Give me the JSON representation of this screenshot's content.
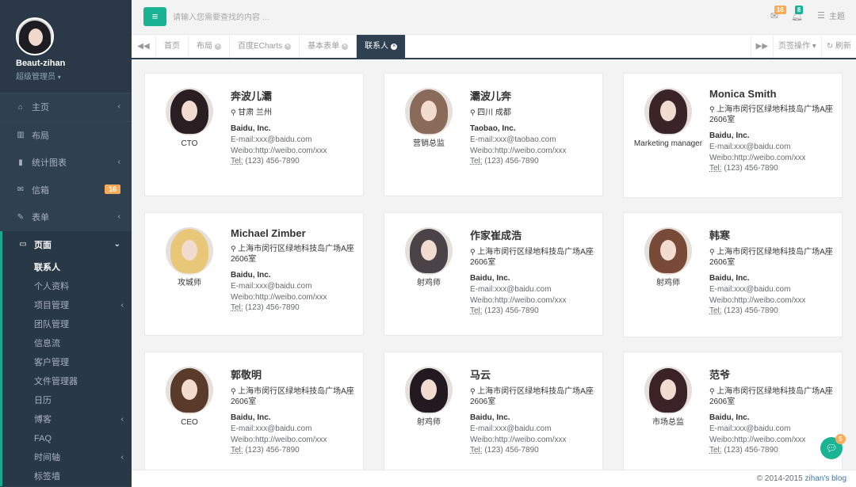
{
  "profile": {
    "name": "Beaut-zihan",
    "role": "超级管理员"
  },
  "sidebar": {
    "items": [
      {
        "label": "主页",
        "icon": "home-icon",
        "glyph": "⌂",
        "arrow": true
      },
      {
        "label": "布局",
        "icon": "columns-icon",
        "glyph": "▥",
        "arrow": false
      },
      {
        "label": "统计图表",
        "icon": "bar-chart-icon",
        "glyph": "▮",
        "arrow": true
      },
      {
        "label": "信箱",
        "icon": "envelope-icon",
        "glyph": "✉",
        "badge": "16"
      },
      {
        "label": "表单",
        "icon": "edit-icon",
        "glyph": "✎",
        "arrow": true
      },
      {
        "label": "页面",
        "icon": "desktop-icon",
        "glyph": "▭",
        "arrow": true
      }
    ],
    "sub_items": [
      {
        "label": "联系人",
        "current": true
      },
      {
        "label": "个人资料"
      },
      {
        "label": "项目管理",
        "arrow": true
      },
      {
        "label": "团队管理"
      },
      {
        "label": "信息流"
      },
      {
        "label": "客户管理"
      },
      {
        "label": "文件管理器"
      },
      {
        "label": "日历"
      },
      {
        "label": "博客",
        "arrow": true
      },
      {
        "label": "FAQ"
      },
      {
        "label": "时间轴",
        "arrow": true
      },
      {
        "label": "标签墙"
      }
    ]
  },
  "topbar": {
    "search_placeholder": "请输入您需要查找的内容 …",
    "messages_badge": "16",
    "alerts_badge": "8",
    "theme_label": "主题"
  },
  "tabs": {
    "items": [
      {
        "label": "首页",
        "closable": false
      },
      {
        "label": "布局",
        "closable": true
      },
      {
        "label": "百度ECharts",
        "closable": true
      },
      {
        "label": "基本表单",
        "closable": true
      },
      {
        "label": "联系人",
        "closable": true,
        "active": true
      }
    ],
    "tab_actions_label": "页签操作",
    "refresh_label": "刷新"
  },
  "contacts": [
    {
      "name": "奔波儿灞",
      "address": "甘肃 兰州",
      "role": "CTO",
      "company": "Baidu, Inc.",
      "email": "E-mail:xxx@baidu.com",
      "weibo": "Weibo:http://weibo.com/xxx",
      "tel_label": "Tel:",
      "tel": " (123) 456-7890",
      "hair": "#2a1e22"
    },
    {
      "name": "灞波儿奔",
      "address": "四川 成都",
      "role": "营销总监",
      "company": "Taobao, Inc.",
      "email": "E-mail:xxx@taobao.com",
      "weibo": "Weibo:http://weibo.com/xxx",
      "tel_label": "Tel:",
      "tel": " (123) 456-7890",
      "hair": "#8a6a58"
    },
    {
      "name": "Monica Smith",
      "address": "上海市闵行区绿地科技岛广场A座2606室",
      "role": "Marketing manager",
      "company": "Baidu, Inc.",
      "email": "E-mail:xxx@baidu.com",
      "weibo": "Weibo:http://weibo.com/xxx",
      "tel_label": "Tel:",
      "tel": " (123) 456-7890",
      "hair": "#3a2428"
    },
    {
      "name": "Michael Zimber",
      "address": "上海市闵行区绿地科技岛广场A座2606室",
      "role": "攻城师",
      "company": "Baidu, Inc.",
      "email": "E-mail:xxx@baidu.com",
      "weibo": "Weibo:http://weibo.com/xxx",
      "tel_label": "Tel:",
      "tel": " (123) 456-7890",
      "hair": "#e8c878"
    },
    {
      "name": "作家崔成浩",
      "address": "上海市闵行区绿地科技岛广场A座2606室",
      "role": "射鸡师",
      "company": "Baidu, Inc.",
      "email": "E-mail:xxx@baidu.com",
      "weibo": "Weibo:http://weibo.com/xxx",
      "tel_label": "Tel:",
      "tel": " (123) 456-7890",
      "hair": "#4a4448"
    },
    {
      "name": "韩寒",
      "address": "上海市闵行区绿地科技岛广场A座2606室",
      "role": "射鸡师",
      "company": "Baidu, Inc.",
      "email": "E-mail:xxx@baidu.com",
      "weibo": "Weibo:http://weibo.com/xxx",
      "tel_label": "Tel:",
      "tel": " (123) 456-7890",
      "hair": "#7a4a38"
    },
    {
      "name": "郭敬明",
      "address": "上海市闵行区绿地科技岛广场A座2606室",
      "role": "CEO",
      "company": "Baidu, Inc.",
      "email": "E-mail:xxx@baidu.com",
      "weibo": "Weibo:http://weibo.com/xxx",
      "tel_label": "Tel:",
      "tel": " (123) 456-7890",
      "hair": "#5a3a2a"
    },
    {
      "name": "马云",
      "address": "上海市闵行区绿地科技岛广场A座2606室",
      "role": "射鸡师",
      "company": "Baidu, Inc.",
      "email": "E-mail:xxx@baidu.com",
      "weibo": "Weibo:http://weibo.com/xxx",
      "tel_label": "Tel:",
      "tel": " (123) 456-7890",
      "hair": "#221a20"
    },
    {
      "name": "范爷",
      "address": "上海市闵行区绿地科技岛广场A座2606室",
      "role": "市场总监",
      "company": "Baidu, Inc.",
      "email": "E-mail:xxx@baidu.com",
      "weibo": "Weibo:http://weibo.com/xxx",
      "tel_label": "Tel:",
      "tel": " (123) 456-7890",
      "hair": "#3a2226"
    }
  ],
  "footer": {
    "copyright": "© 2014-2015 ",
    "link": "zihan's blog"
  },
  "chat": {
    "badge": "5"
  },
  "colors": {
    "accent": "#1ab394",
    "sidebar": "#2f4050",
    "warning": "#f8ac59"
  }
}
